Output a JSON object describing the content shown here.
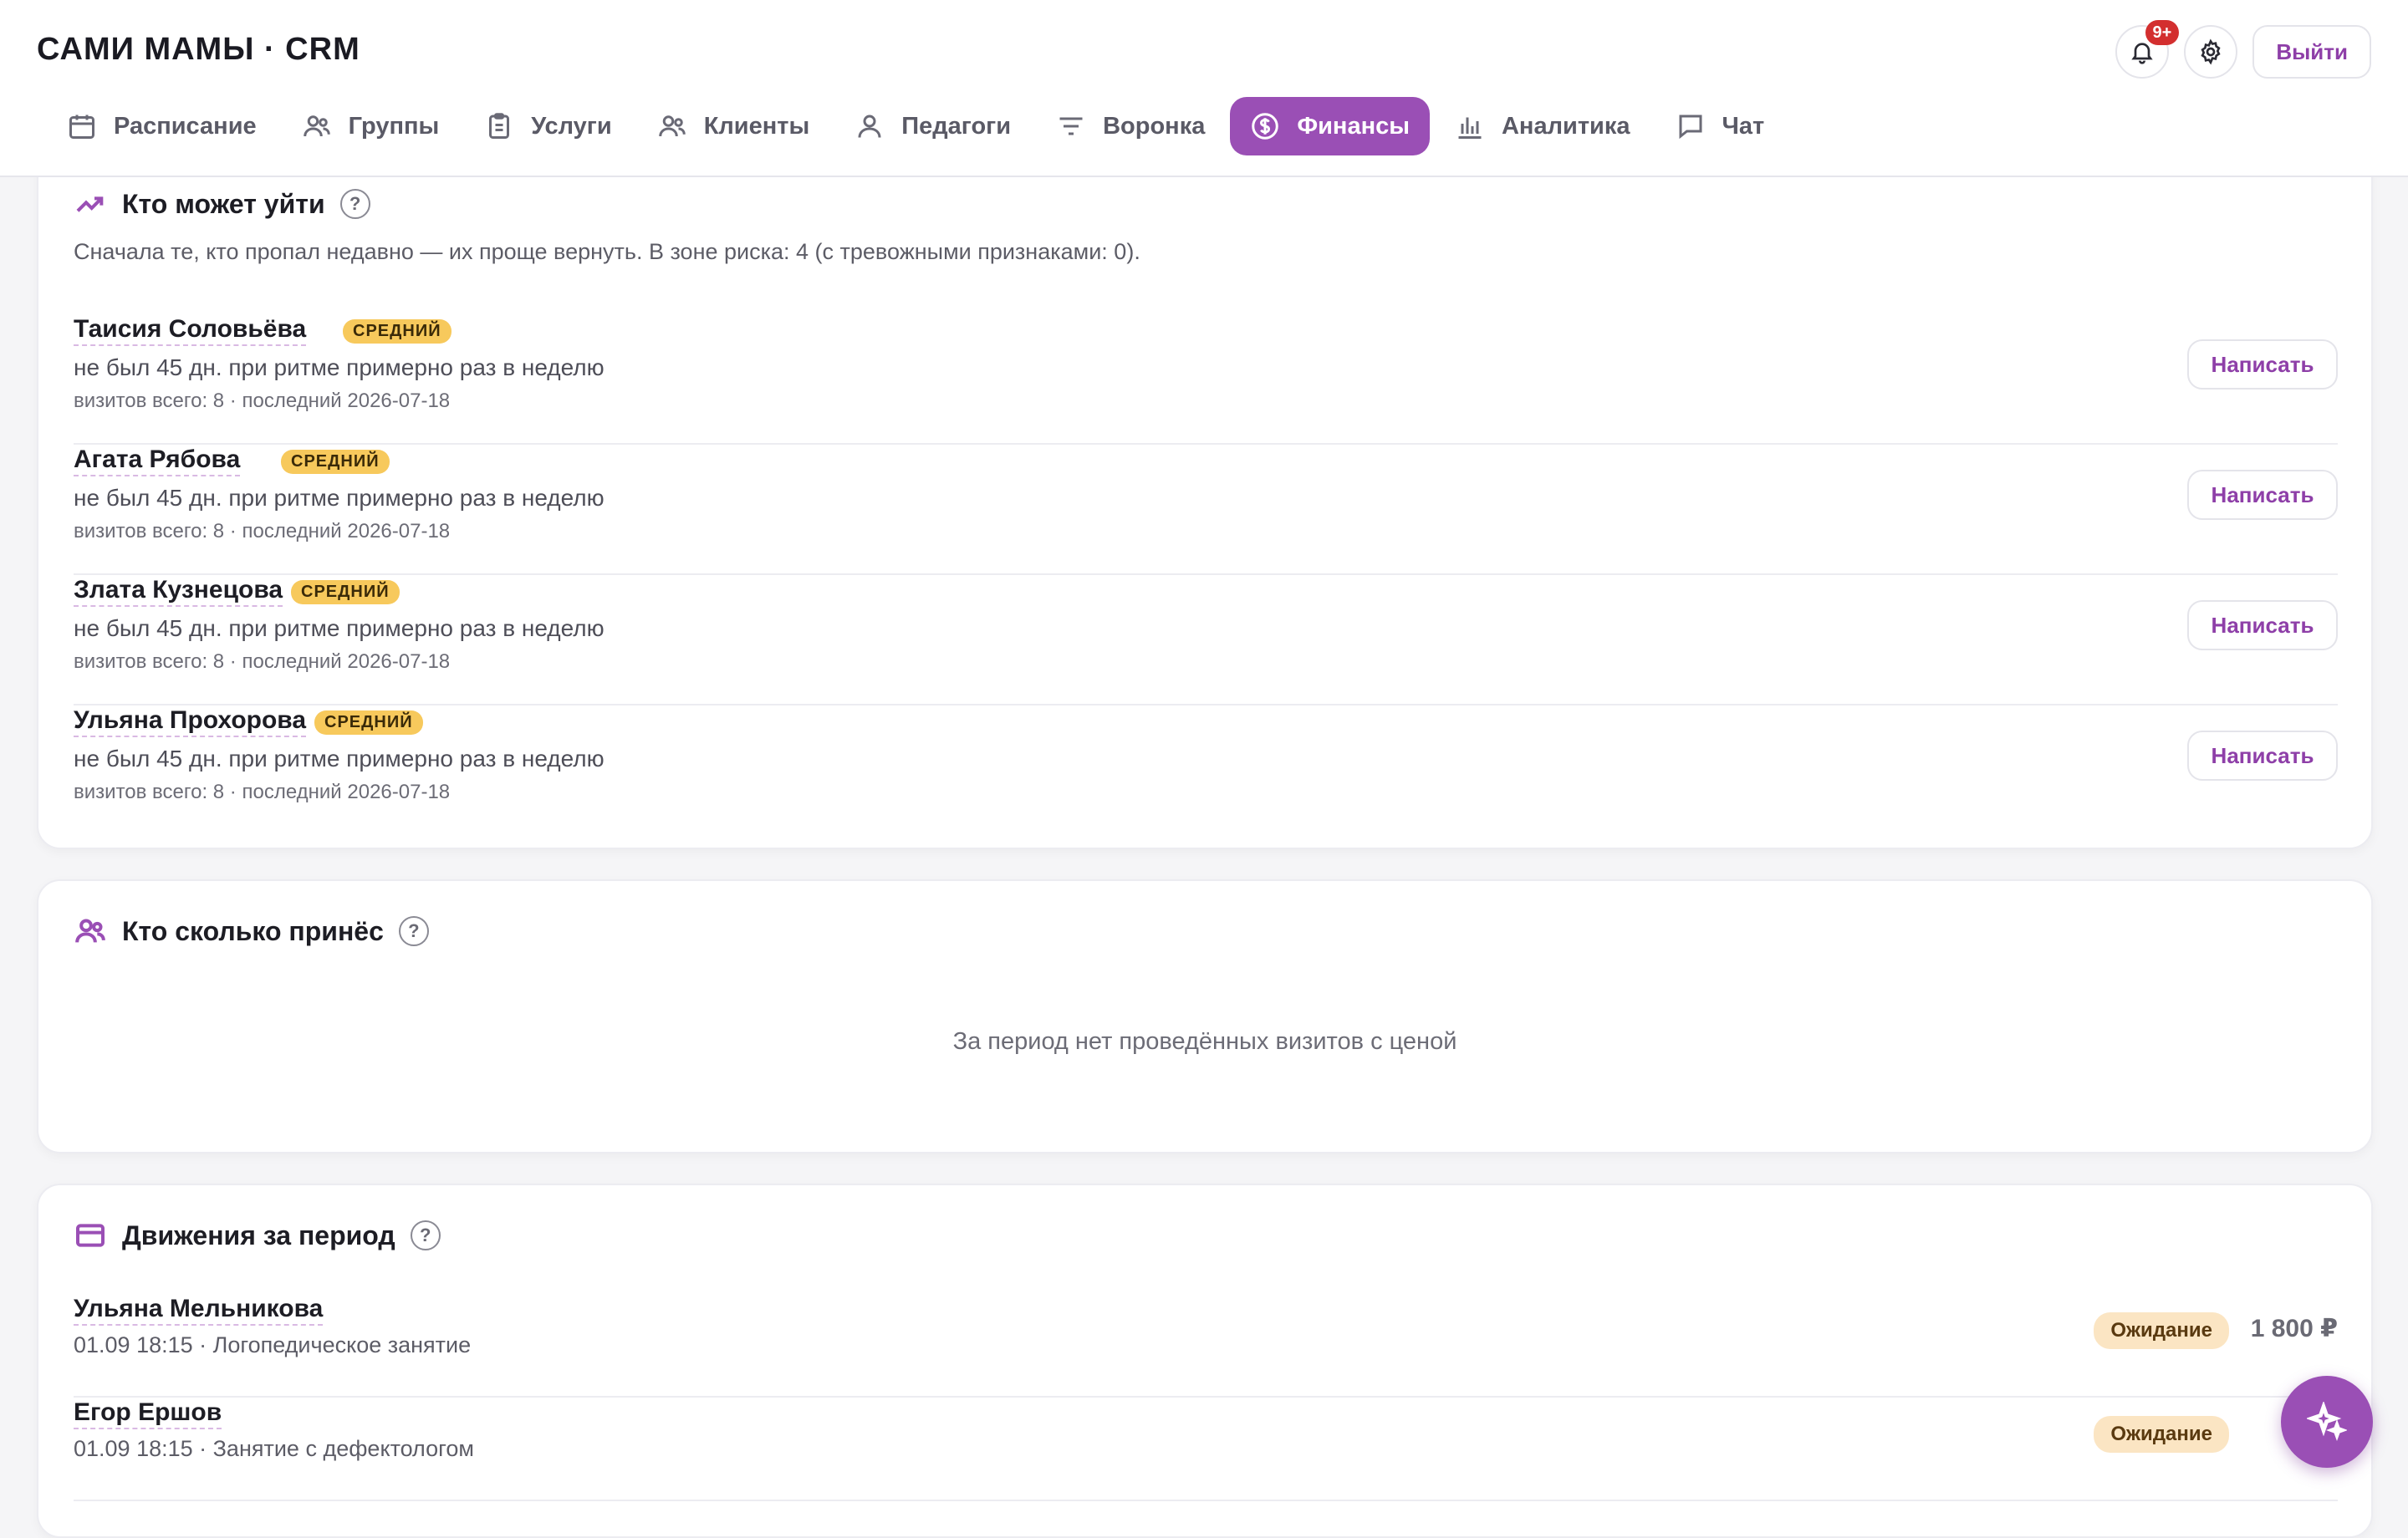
{
  "app": {
    "title": "САМИ МАМЫ · CRM",
    "notifications_count": "9+",
    "logout_label": "Выйти"
  },
  "nav": [
    {
      "label": "Расписание",
      "icon": "calendar-icon",
      "active": false
    },
    {
      "label": "Группы",
      "icon": "users-icon",
      "active": false
    },
    {
      "label": "Услуги",
      "icon": "clipboard-icon",
      "active": false
    },
    {
      "label": "Клиенты",
      "icon": "users-icon",
      "active": false
    },
    {
      "label": "Педагоги",
      "icon": "user-icon",
      "active": false
    },
    {
      "label": "Воронка",
      "icon": "filter-icon",
      "active": false
    },
    {
      "label": "Финансы",
      "icon": "dollar-circle-icon",
      "active": true
    },
    {
      "label": "Аналитика",
      "icon": "bar-chart-icon",
      "active": false
    },
    {
      "label": "Чат",
      "icon": "chat-icon",
      "active": false
    }
  ],
  "churn": {
    "title": "Кто может уйти",
    "subtitle": "Сначала те, кто пропал недавно — их проще вернуть. В зоне риска: 4 (с тревожными признаками: 0).",
    "write_label": "Написать",
    "items": [
      {
        "name": "Таисия Соловьёва",
        "risk": "СРЕДНИЙ",
        "desc": "не был 45 дн. при ритме примерно раз в неделю",
        "meta": "визитов всего: 8 · последний 2026-07-18"
      },
      {
        "name": "Агата Рябова",
        "risk": "СРЕДНИЙ",
        "desc": "не был 45 дн. при ритме примерно раз в неделю",
        "meta": "визитов всего: 8 · последний 2026-07-18"
      },
      {
        "name": "Злата Кузнецова",
        "risk": "СРЕДНИЙ",
        "desc": "не был 45 дн. при ритме примерно раз в неделю",
        "meta": "визитов всего: 8 · последний 2026-07-18"
      },
      {
        "name": "Ульяна Прохорова",
        "risk": "СРЕДНИЙ",
        "desc": "не был 45 дн. при ритме примерно раз в неделю",
        "meta": "визитов всего: 8 · последний 2026-07-18"
      }
    ]
  },
  "revenue": {
    "title": "Кто сколько принёс",
    "empty": "За период нет проведённых визитов с ценой"
  },
  "movements": {
    "title": "Движения за период",
    "items": [
      {
        "name": "Ульяна Мельникова",
        "desc": "01.09 18:15 · Логопедическое занятие",
        "status": "Ожидание",
        "amount": "1 800 ₽"
      },
      {
        "name": "Егор Ершов",
        "desc": "01.09 18:15 · Занятие с дефектологом",
        "status": "Ожидание",
        "amount": "1 9"
      }
    ]
  },
  "colors": {
    "accent": "#9a4fb5",
    "badge_risk": "#f7c95c",
    "status_pending": "#fbe5c3",
    "notif": "#d32f2f"
  }
}
